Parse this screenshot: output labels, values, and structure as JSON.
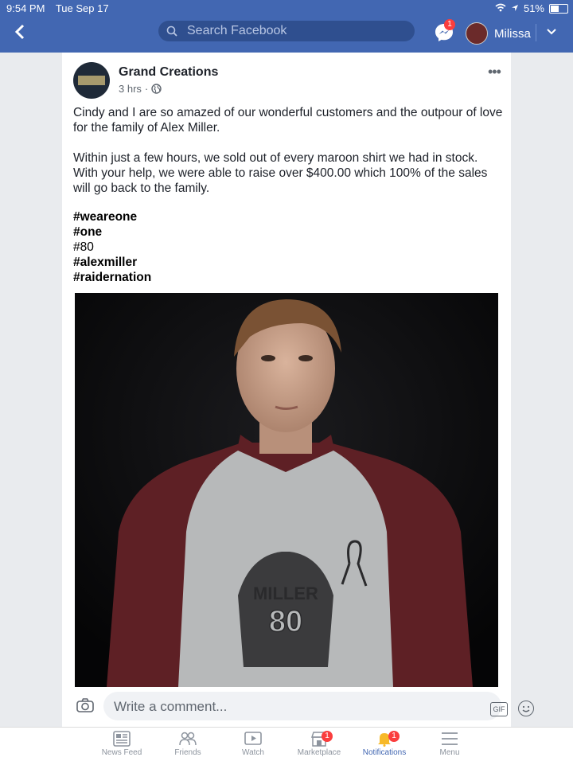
{
  "status_bar": {
    "time": "9:54 PM",
    "date": "Tue Sep 17",
    "battery": "51%",
    "battery_level": 0.51
  },
  "header": {
    "search_placeholder": "Search Facebook",
    "messenger_badge": "1",
    "profile_name": "Milissa"
  },
  "post": {
    "author": "Grand Creations",
    "time": "3 hrs",
    "paragraphs": [
      "Cindy and I are so amazed of our wonderful customers and the outpour of love for the family of Alex Miller.",
      "Within just a few hours, we sold out of every maroon shirt we had in stock. With your help, we were able to raise over $400.00 which 100% of the sales will go back to the family."
    ],
    "hashtags": [
      "#weareone",
      "#one",
      "#80",
      "#alexmiller",
      "#raidernation"
    ],
    "shirt_text": {
      "name": "MILLER",
      "number": "80"
    }
  },
  "comment": {
    "placeholder": "Write a comment...",
    "gif_label": "GIF"
  },
  "tabs": [
    {
      "label": "News Feed",
      "icon": "news-feed-icon",
      "badge": ""
    },
    {
      "label": "Friends",
      "icon": "friends-icon",
      "badge": ""
    },
    {
      "label": "Watch",
      "icon": "watch-icon",
      "badge": ""
    },
    {
      "label": "Marketplace",
      "icon": "marketplace-icon",
      "badge": "1"
    },
    {
      "label": "Notifications",
      "icon": "bell-icon",
      "badge": "1"
    },
    {
      "label": "Menu",
      "icon": "menu-icon",
      "badge": ""
    }
  ],
  "colors": {
    "brand": "#4267b2",
    "badge": "#fa3e3e",
    "shirt_maroon": "#5e2025",
    "shirt_gray": "#b7b9ba"
  }
}
